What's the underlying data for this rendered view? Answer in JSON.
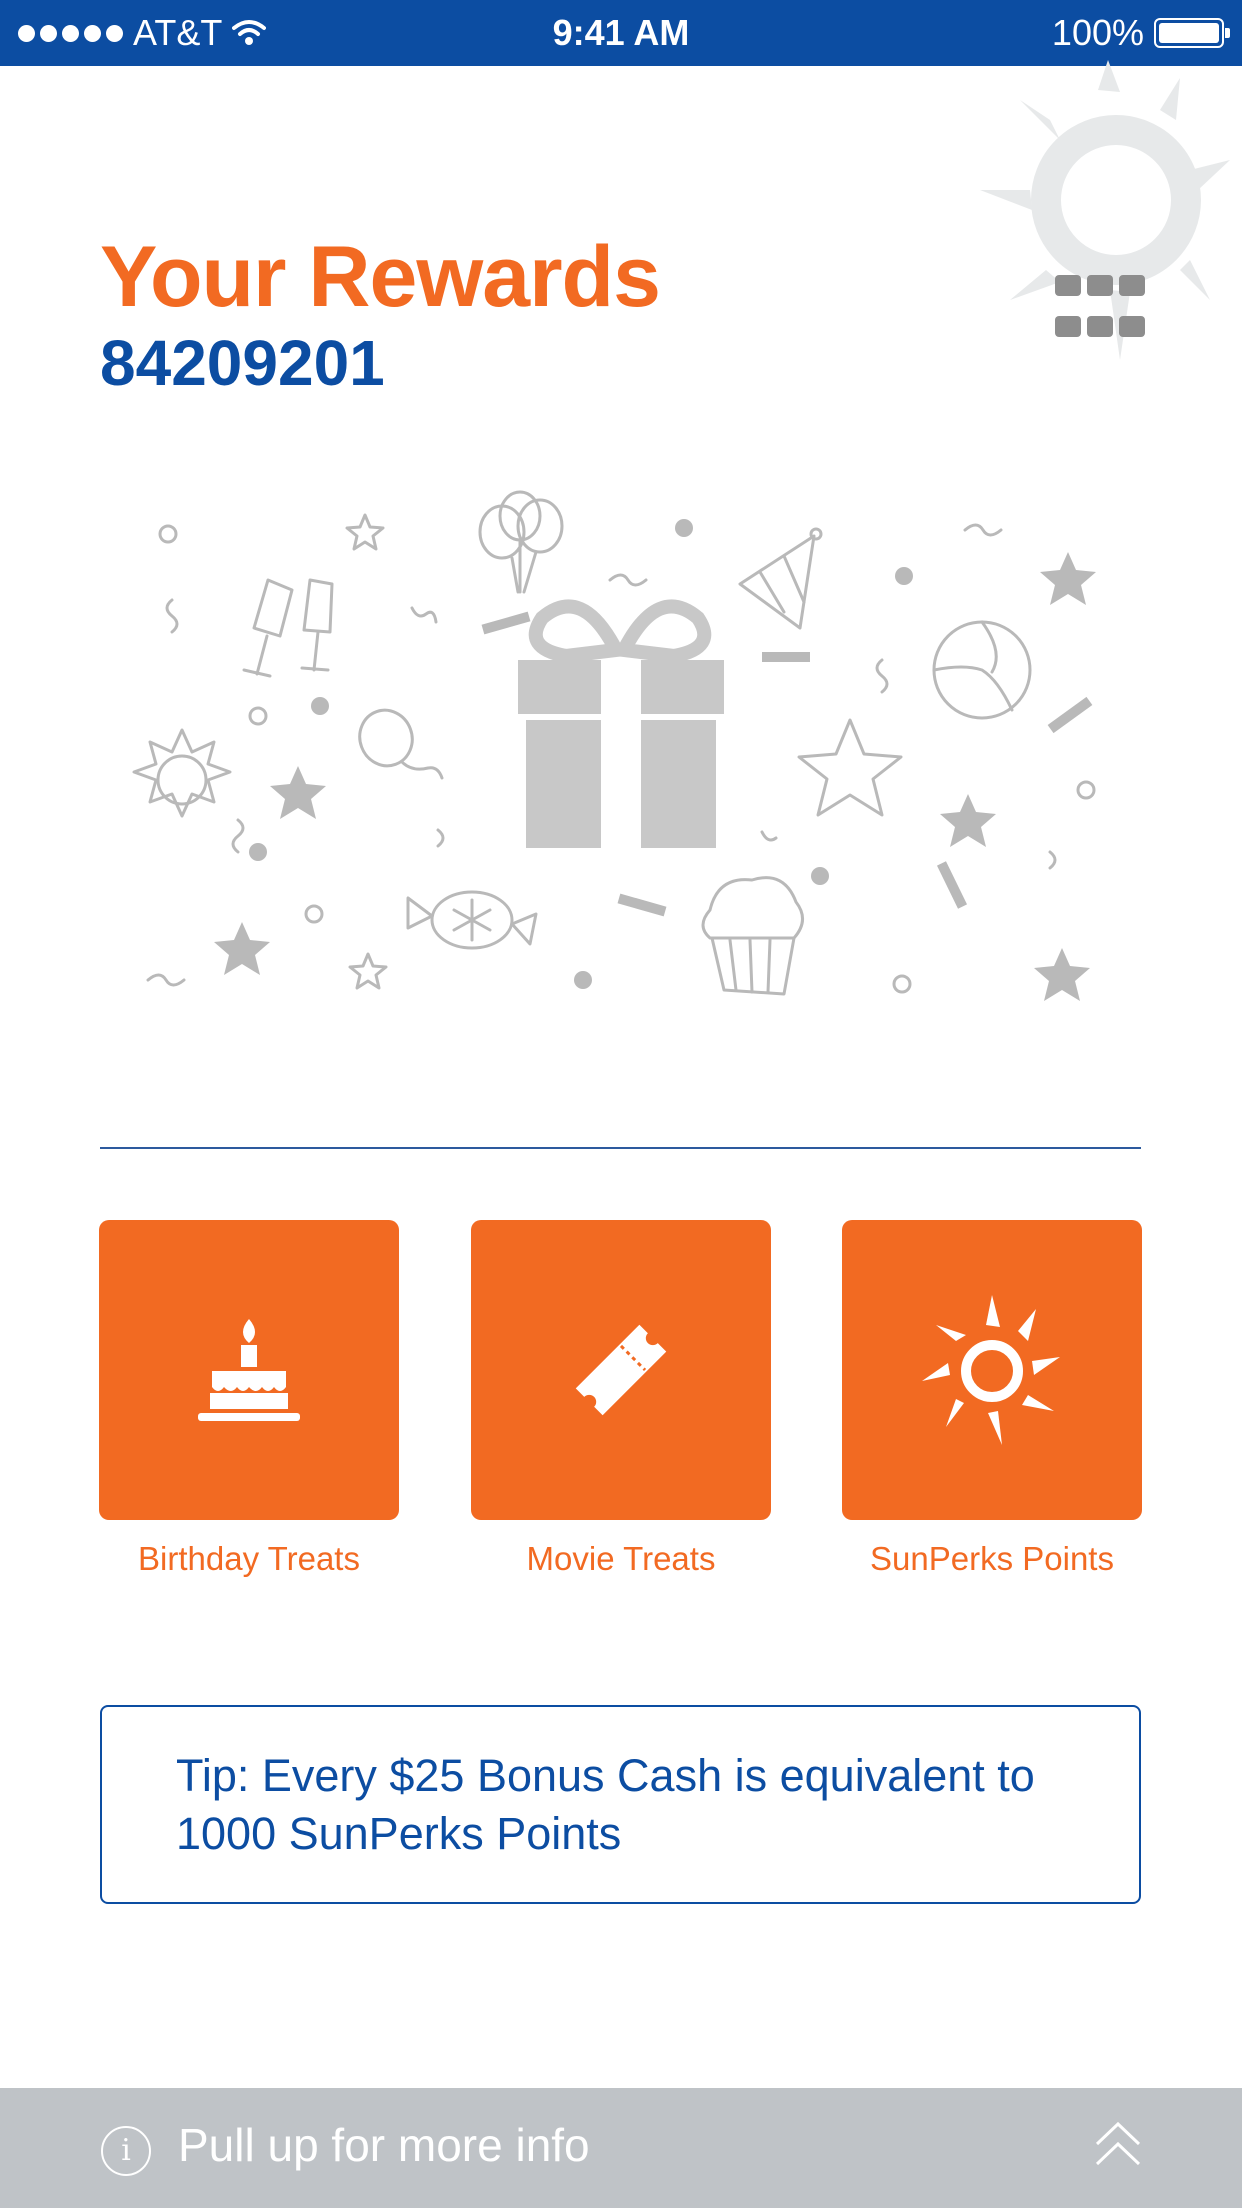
{
  "status_bar": {
    "carrier": "AT&T",
    "time": "9:41 AM",
    "battery": "100%"
  },
  "header": {
    "title": "Your Rewards",
    "member_id": "84209201"
  },
  "tiles": [
    {
      "label": "Birthday Treats",
      "icon": "birthday-cake-icon"
    },
    {
      "label": "Movie Treats",
      "icon": "movie-ticket-icon"
    },
    {
      "label": "SunPerks Points",
      "icon": "sun-icon"
    }
  ],
  "tip": {
    "text": "Tip: Every $25 Bonus Cash is equivalent to 1000 SunPerks Points"
  },
  "bottom_bar": {
    "text": "Pull up for more info"
  },
  "colors": {
    "brand_blue": "#0c4da2",
    "brand_orange": "#f26a22",
    "illustration_gray": "#c8c8c8",
    "bottom_bar_gray": "#bfc3c7"
  }
}
